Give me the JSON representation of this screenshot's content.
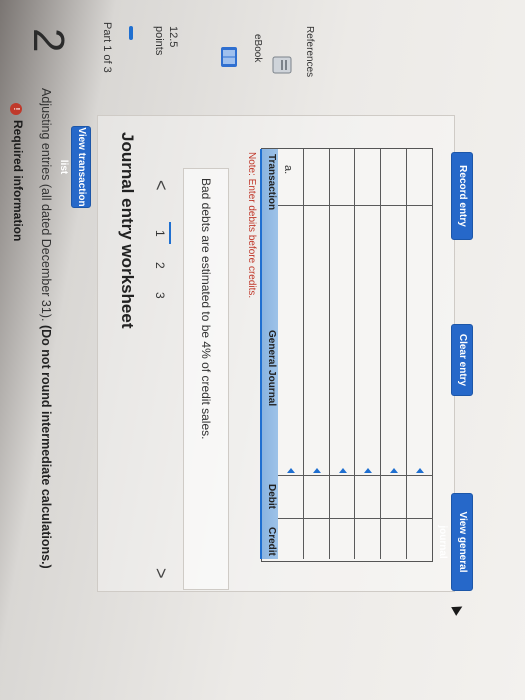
{
  "sidebar": {
    "question_number": "2",
    "part_label": "Part 1 of 3",
    "points_value": "12.5",
    "points_label": "points",
    "ebook_label": "eBook",
    "references_label": "References"
  },
  "header": {
    "info_badge": "!",
    "required_info": "Required information",
    "instructions_plain": "Adjusting entries (all dated December 31). ",
    "instructions_bold": "(Do not round intermediate calculations.)",
    "view_transaction_list": "View transaction list"
  },
  "worksheet": {
    "title": "Journal entry worksheet",
    "prev": "<",
    "next": ">",
    "steps": [
      "1",
      "2",
      "3"
    ],
    "active_step": "1",
    "description": "Bad debts are estimated to be 4% of credit sales.",
    "note": "Note: Enter debits before credits."
  },
  "table": {
    "headers": {
      "transaction": "Transaction",
      "general_journal": "General Journal",
      "debit": "Debit",
      "credit": "Credit"
    },
    "rows": [
      {
        "transaction": "a.",
        "account": "",
        "debit": "",
        "credit": ""
      },
      {
        "transaction": "",
        "account": "",
        "debit": "",
        "credit": ""
      },
      {
        "transaction": "",
        "account": "",
        "debit": "",
        "credit": ""
      },
      {
        "transaction": "",
        "account": "",
        "debit": "",
        "credit": ""
      },
      {
        "transaction": "",
        "account": "",
        "debit": "",
        "credit": ""
      },
      {
        "transaction": "",
        "account": "",
        "debit": "",
        "credit": ""
      }
    ]
  },
  "buttons": {
    "record_entry": "Record entry",
    "clear_entry": "Clear entry",
    "view_general_journal": "View general journal"
  },
  "colors": {
    "accent": "#2668c9",
    "note": "#c0392b"
  }
}
